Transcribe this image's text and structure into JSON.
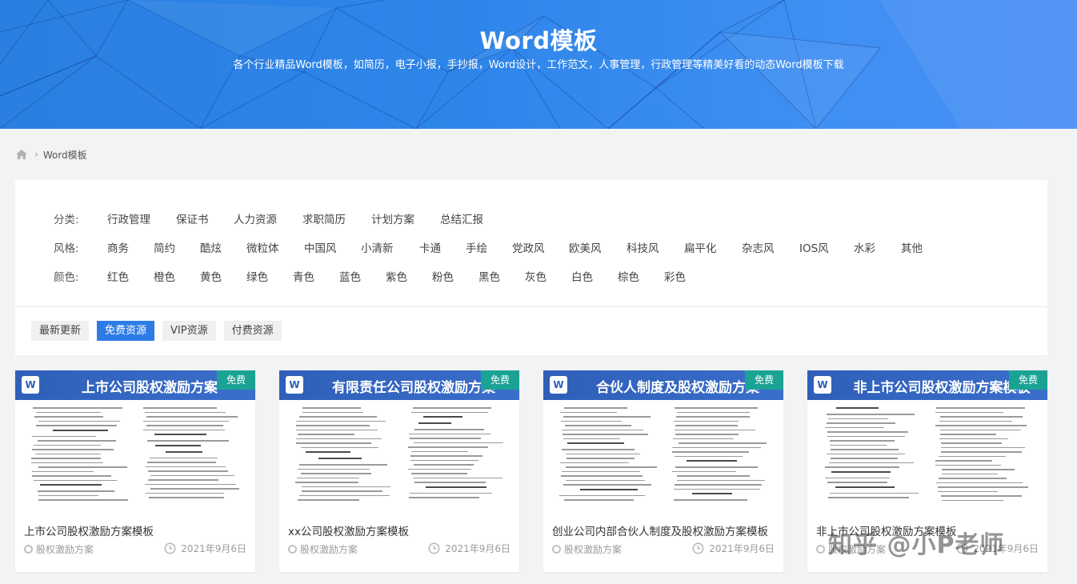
{
  "banner": {
    "title": "Word模板",
    "subtitle": "各个行业精品Word模板，如简历，电子小报，手抄报，Word设计，工作范文，人事管理，行政管理等精美好看的动态Word模板下载"
  },
  "breadcrumb": {
    "home_icon": "home-icon",
    "current": "Word模板"
  },
  "filters": {
    "category": {
      "label": "分类:",
      "items": [
        "行政管理",
        "保证书",
        "人力资源",
        "求职简历",
        "计划方案",
        "总结汇报"
      ]
    },
    "style": {
      "label": "风格:",
      "items": [
        "商务",
        "简约",
        "酷炫",
        "微粒体",
        "中国风",
        "小清新",
        "卡通",
        "手绘",
        "党政风",
        "欧美风",
        "科技风",
        "扁平化",
        "杂志风",
        "IOS风",
        "水彩",
        "其他"
      ]
    },
    "color": {
      "label": "颜色:",
      "items": [
        "红色",
        "橙色",
        "黄色",
        "绿色",
        "青色",
        "蓝色",
        "紫色",
        "粉色",
        "黑色",
        "灰色",
        "白色",
        "棕色",
        "彩色"
      ]
    }
  },
  "tabs": [
    {
      "label": "最新更新",
      "active": false
    },
    {
      "label": "免费资源",
      "active": true
    },
    {
      "label": "VIP资源",
      "active": false
    },
    {
      "label": "付费资源",
      "active": false
    }
  ],
  "cards": [
    {
      "thumb_title": "上市公司股权激励方案",
      "badge": "免费",
      "title": "上市公司股权激励方案模板",
      "tag": "股权激励方案",
      "date": "2021年9月6日"
    },
    {
      "thumb_title": "有限责任公司股权激励方案",
      "badge": "免费",
      "title": "xx公司股权激励方案模板",
      "tag": "股权激励方案",
      "date": "2021年9月6日"
    },
    {
      "thumb_title": "合伙人制度及股权激励方案",
      "badge": "免费",
      "title": "创业公司内部合伙人制度及股权激励方案模板",
      "tag": "股权激励方案",
      "date": "2021年9月6日"
    },
    {
      "thumb_title": "非上市公司股权激励方案模板",
      "badge": "免费",
      "title": "非上市公司股权激励方案模板",
      "tag": "股权激励方案",
      "date": "2021年9月6日"
    }
  ],
  "watermark": "知乎 @小P老师",
  "colors": {
    "accent": "#2d7ce6",
    "free_badge": "#1aa394",
    "banner_blue": "#2f86ea"
  }
}
